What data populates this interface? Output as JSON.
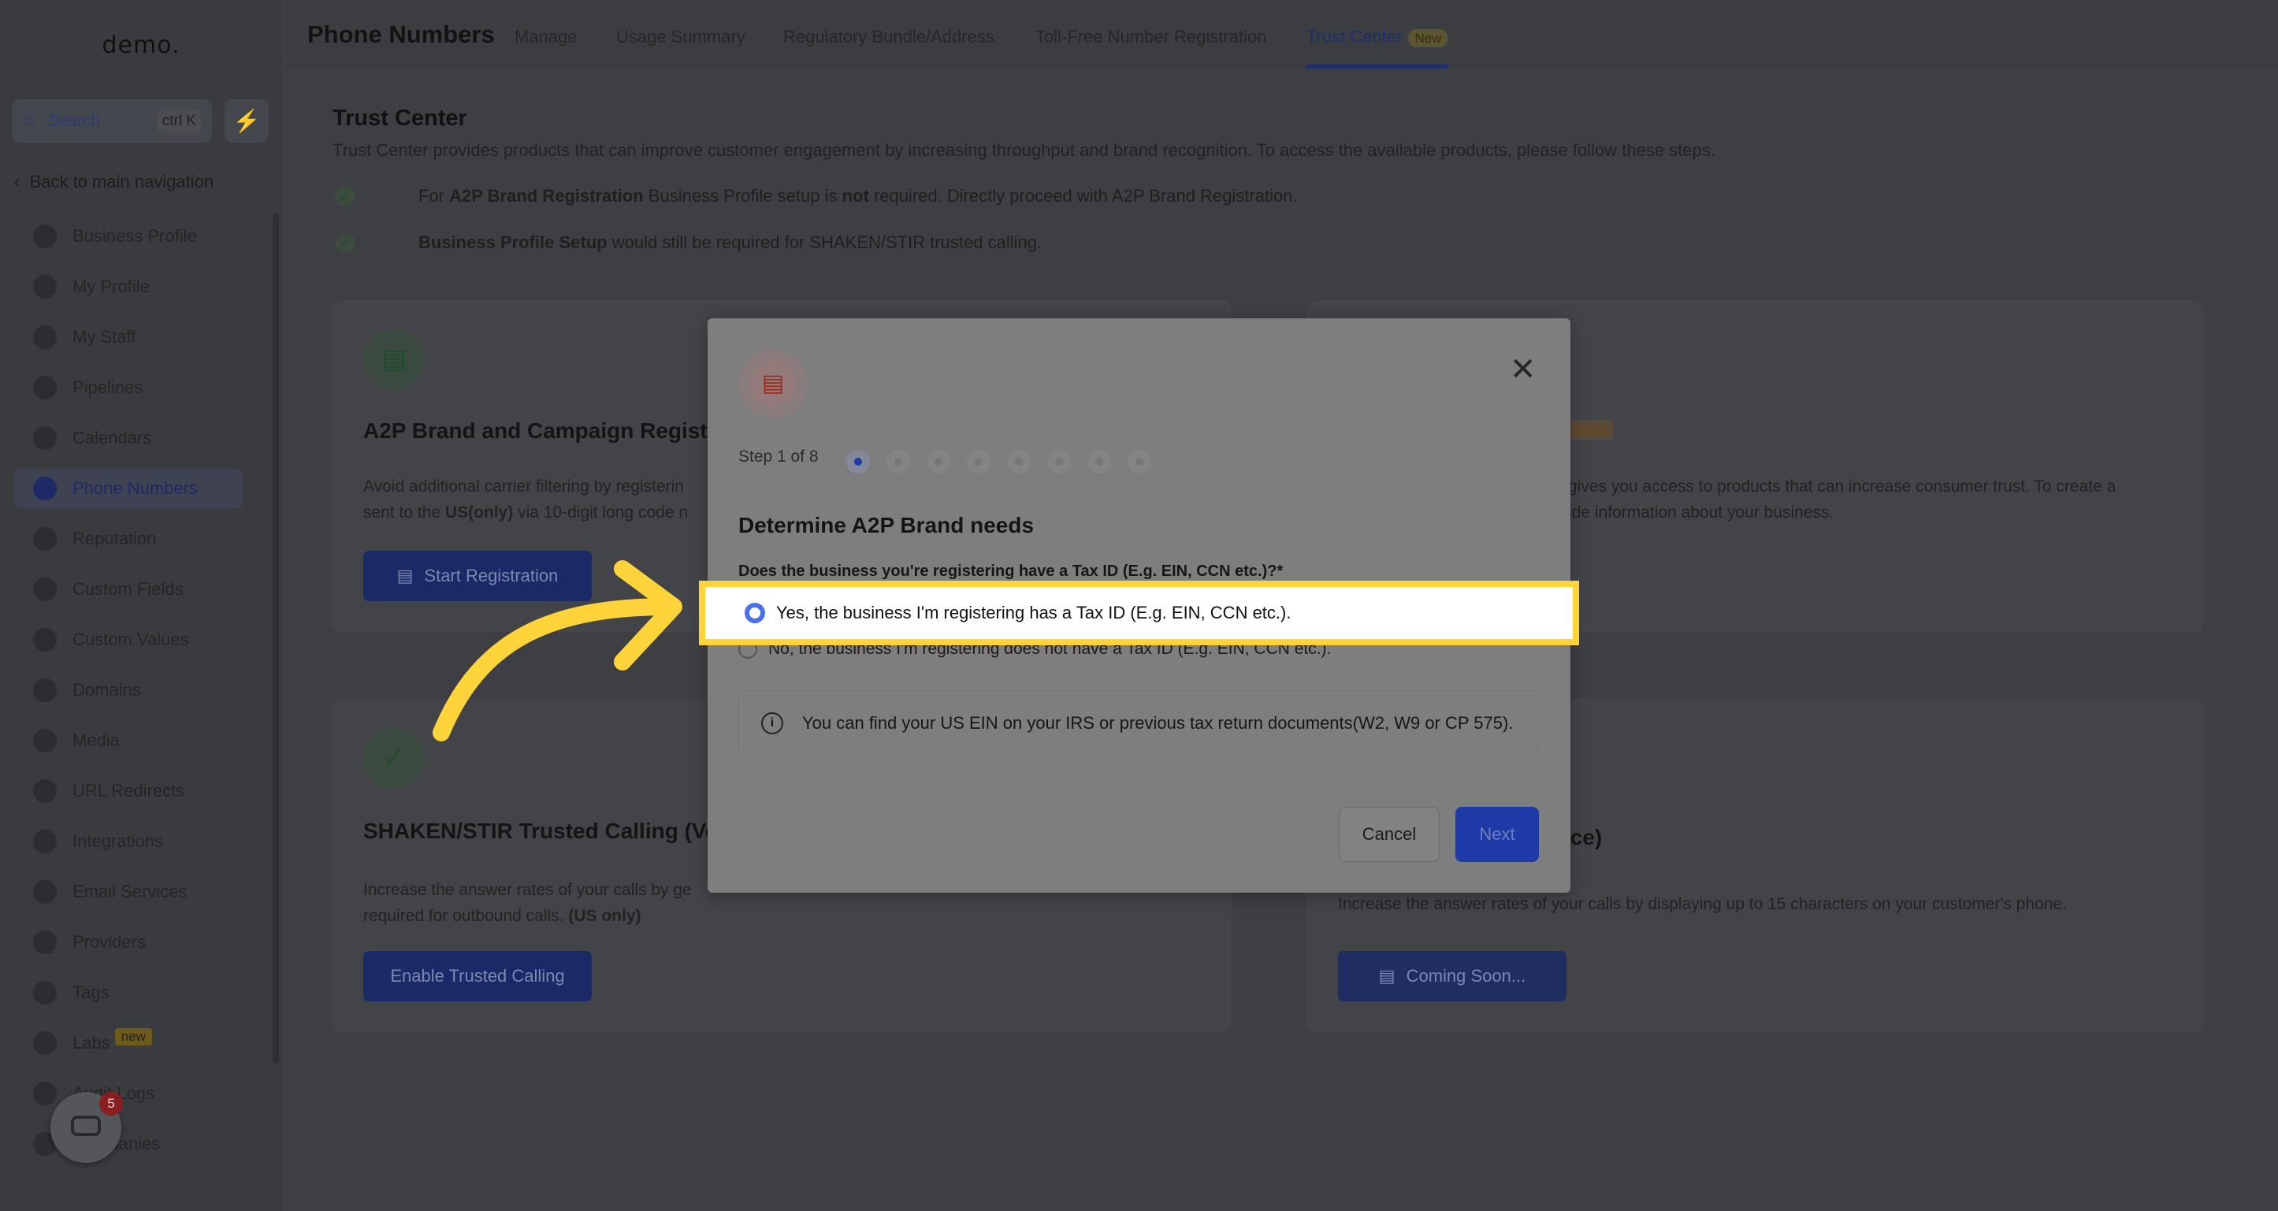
{
  "sidebar": {
    "logo": "demo.",
    "search_label": "Search",
    "search_shortcut": "ctrl K",
    "back_label": "Back to main navigation",
    "items": [
      {
        "label": "Business Profile"
      },
      {
        "label": "My Profile"
      },
      {
        "label": "My Staff"
      },
      {
        "label": "Pipelines"
      },
      {
        "label": "Calendars"
      },
      {
        "label": "Phone Numbers",
        "active": true
      },
      {
        "label": "Reputation"
      },
      {
        "label": "Custom Fields"
      },
      {
        "label": "Custom Values"
      },
      {
        "label": "Domains"
      },
      {
        "label": "Media"
      },
      {
        "label": "URL Redirects"
      },
      {
        "label": "Integrations"
      },
      {
        "label": "Email Services"
      },
      {
        "label": "Providers"
      },
      {
        "label": "Tags"
      },
      {
        "label": "Labs",
        "badge": "new"
      },
      {
        "label": "Audit Logs"
      },
      {
        "label": "Companies"
      }
    ],
    "chat_count": "5"
  },
  "header": {
    "title": "Phone Numbers",
    "tabs": [
      {
        "label": "Manage"
      },
      {
        "label": "Usage Summary"
      },
      {
        "label": "Regulatory Bundle/Address"
      },
      {
        "label": "Toll-Free Number Registration"
      },
      {
        "label": "Trust Center",
        "badge": "New",
        "active": true
      }
    ]
  },
  "main": {
    "title": "Trust Center",
    "description": "Trust Center provides products that can improve customer engagement by increasing throughput and brand recognition. To access the available products, please follow these steps.",
    "checks": [
      {
        "pre": "For ",
        "bold": "A2P Brand Registration",
        "mid": " Business Profile setup is ",
        "bold2": "not",
        "post": " required. Directly proceed with A2P Brand Registration."
      },
      {
        "bold": "Business Profile Setup",
        "post": " would still be required for SHAKEN/STIR trusted calling."
      }
    ],
    "cards": [
      {
        "title": "A2P Brand and Campaign Registra",
        "text1": "Avoid additional carrier filtering by registerin",
        "text2_pre": "sent to the ",
        "text2_bold": "US(only)",
        "text2_post": " via 10-digit long code n",
        "button": "Start Registration"
      },
      {
        "badge": "eview",
        "text1": "gives you access to products that can increase consumer trust. To create a",
        "text2": "ide information about your business."
      },
      {
        "title": "SHAKEN/STIR Trusted Calling (Vo",
        "text1": "Increase the answer rates of your calls by ge",
        "text2_pre": "required for outbound calls. ",
        "text2_bold": "(US only)",
        "button": "Enable Trusted Calling"
      },
      {
        "title": "ice)",
        "text1": "Increase the answer rates of your calls by displaying up to 15 characters on your customer's phone.",
        "button": "Coming Soon..."
      }
    ]
  },
  "modal": {
    "step_label": "Step 1 of 8",
    "total_steps": 8,
    "current_step": 1,
    "title": "Determine A2P Brand needs",
    "question": "Does the business you're registering have a Tax ID (E.g. EIN, CCN etc.)?*",
    "options": [
      {
        "label": "Yes, the business I'm registering has a Tax ID (E.g. EIN, CCN etc.).",
        "selected": true
      },
      {
        "label": "No, the business I'm registering does not have a Tax ID (E.g. EIN, CCN etc.).",
        "selected": false
      }
    ],
    "info": "You can find your US EIN on your IRS or previous tax return documents(W2, W9 or CP 575).",
    "cancel": "Cancel",
    "next": "Next"
  },
  "colors": {
    "accent": "#1d3aa6",
    "highlight": "#ffd43b"
  }
}
